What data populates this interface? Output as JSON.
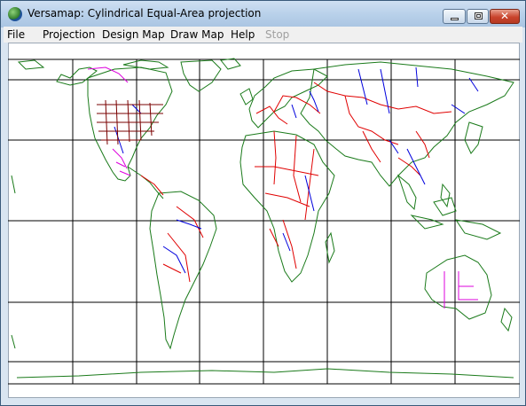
{
  "window": {
    "title": "Versamap: Cylindrical Equal-Area projection",
    "app_icon": "globe-icon"
  },
  "menu": {
    "items": [
      {
        "label": "File",
        "enabled": true
      },
      {
        "label": "Projection",
        "enabled": true
      },
      {
        "label": "Design Map",
        "enabled": true
      },
      {
        "label": "Draw Map",
        "enabled": true
      },
      {
        "label": "Help",
        "enabled": true
      },
      {
        "label": "Stop",
        "enabled": false
      }
    ]
  },
  "map": {
    "projection": "Cylindrical Equal-Area",
    "graticule_color": "#000000",
    "coastline_color": "#1a7a1a",
    "border_color": "#e00000",
    "river_color": "#0000dd",
    "state_border_color": "#dd00dd",
    "us_state_color": "#7a0000"
  }
}
